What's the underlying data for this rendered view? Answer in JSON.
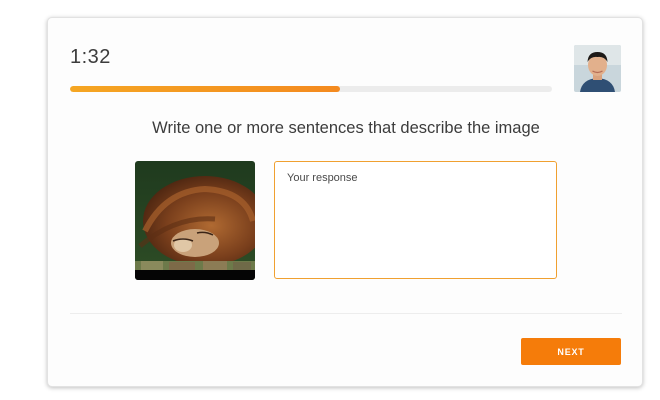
{
  "timer": {
    "value": "1:32"
  },
  "progress": {
    "fraction": 0.56,
    "track_color": "#ececec",
    "fill_color": "#f48a1f"
  },
  "question": {
    "prompt": "Write one or more sentences that describe the image"
  },
  "image": {
    "subject": "lion-photo"
  },
  "response": {
    "placeholder": "Your response",
    "value": "",
    "border_color": "#f0a030"
  },
  "footer": {
    "next_label": "NEXT",
    "next_color": "#f57c0a"
  },
  "avatar": {
    "icon": "user-avatar"
  }
}
